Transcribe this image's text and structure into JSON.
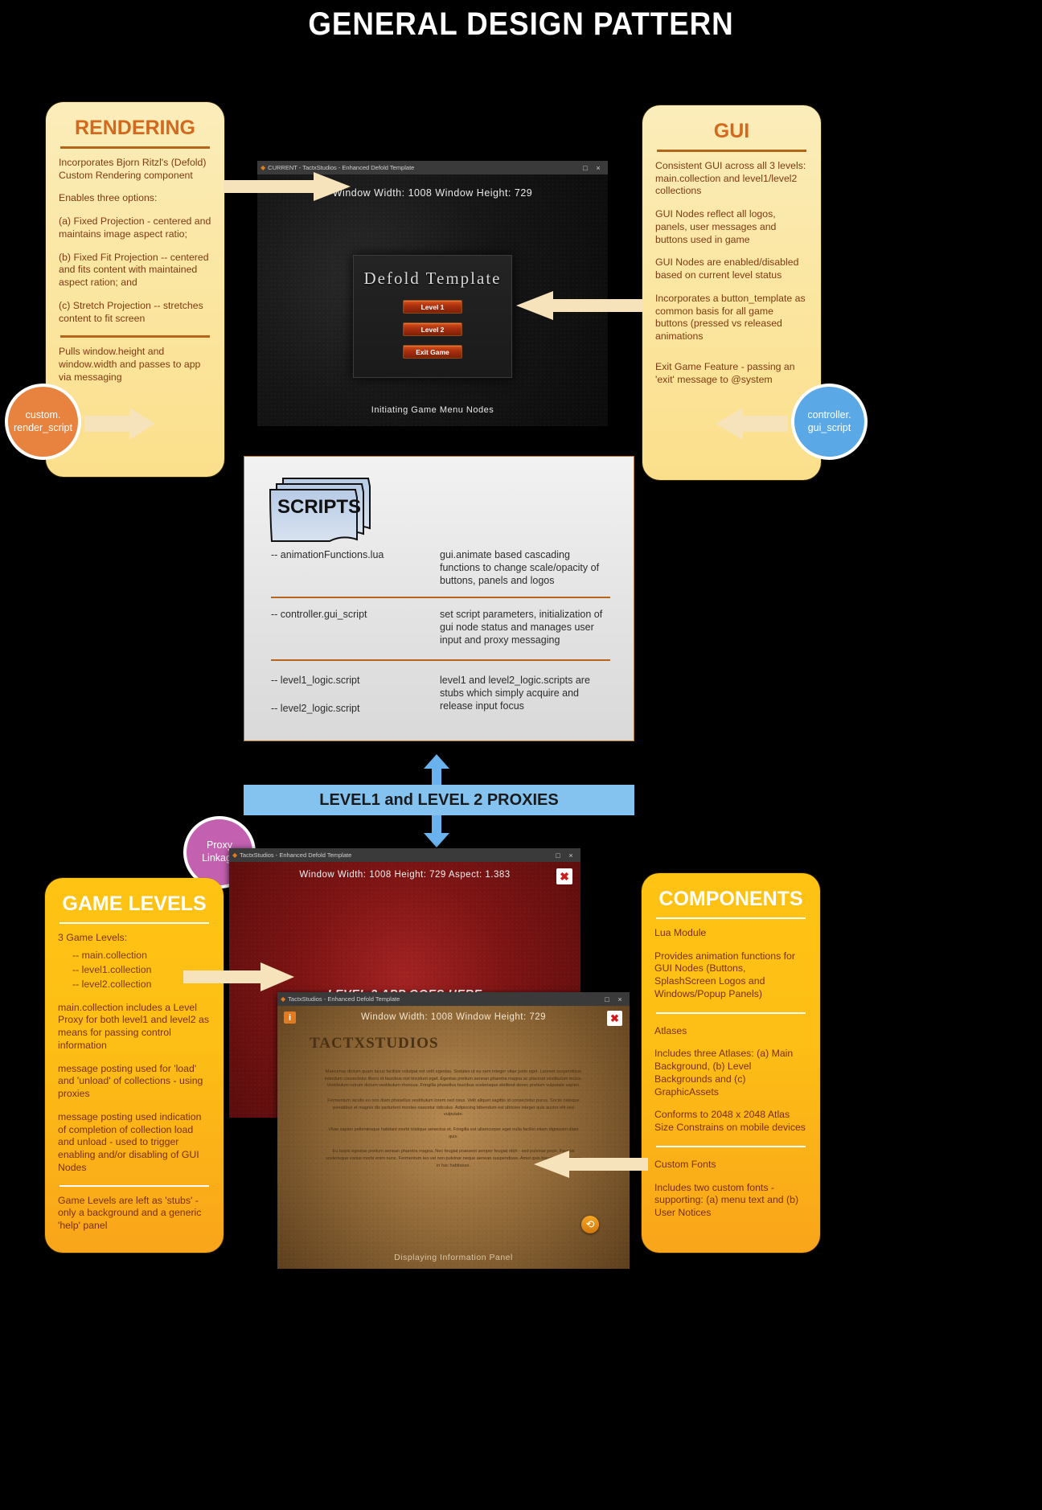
{
  "title": "GENERAL DESIGN PATTERN",
  "panels": {
    "rendering": {
      "heading": "RENDERING",
      "paras": [
        "Incorporates Bjorn Ritzl's (Defold) Custom Rendering component",
        "Enables three options:",
        "(a) Fixed Projection - centered and maintains image aspect ratio;",
        "(b) Fixed Fit Projection -- centered and fits content with maintained aspect ration; and",
        "(c) Stretch Projection -- stretches content to fit screen"
      ],
      "footer": "Pulls window.height and window.width and passes to app via messaging"
    },
    "gui": {
      "heading": "GUI",
      "paras": [
        "Consistent GUI across all 3 levels: main.collection and level1/level2 collections",
        "GUI Nodes reflect all logos, panels, user messages and buttons used in game",
        "GUI Nodes are enabled/disabled based on current level status",
        "Incorporates a button_template as common basis for all game buttons (pressed vs released animations",
        "Exit Game Feature - passing an 'exit' message to @system"
      ]
    },
    "game_levels": {
      "heading": "GAME LEVELS",
      "intro": "3 Game Levels:",
      "bullets": [
        "-- main.collection",
        "-- level1.collection",
        "-- level2.collection"
      ],
      "paras": [
        "main.collection includes a Level Proxy for both level1 and level2 as means for passing control information",
        "message posting used for 'load' and 'unload' of collections - using proxies",
        "message posting used indication of completion of collection load and unload - used to trigger enabling and/or disabling of GUI Nodes"
      ],
      "footer": "Game Levels are left as 'stubs' - only a background and a generic 'help' panel"
    },
    "components": {
      "heading": "COMPONENTS",
      "groups": [
        {
          "title": "Lua Module",
          "body": "Provides animation functions for GUI Nodes (Buttons, SplashScreen Logos and Windows/Popup Panels)"
        },
        {
          "title": "Atlases",
          "body": "Includes three Atlases: (a) Main Background, (b) Level Backgrounds and (c) GraphicAssets",
          "body2": "Conforms to 2048 x 2048 Atlas Size Constrains on mobile devices"
        },
        {
          "title": "Custom Fonts",
          "body": "Includes two custom fonts - supporting: (a) menu text and (b) User Notices"
        }
      ]
    }
  },
  "badges": {
    "render_script": "custom.\nrender_script",
    "gui_script": "controller.\ngui_script",
    "proxy_linkage": "Proxy\nLinkage"
  },
  "scripts_card": {
    "folder_label": "SCRIPTS",
    "rows": [
      {
        "name": "-- animationFunctions.lua",
        "desc": "gui.animate based cascading functions to change scale/opacity of buttons, panels and logos"
      },
      {
        "name": "-- controller.gui_script",
        "desc": "set script parameters, initialization of gui node status and manages user input and proxy messaging"
      },
      {
        "name": "-- level1_logic.script",
        "name2": "-- level2_logic.script",
        "desc": "level1 and level2_logic.scripts are stubs which simply acquire and release input focus"
      }
    ]
  },
  "proxy_bar": {
    "label": "LEVEL1 and LEVEL 2 PROXIES"
  },
  "windows": {
    "main_menu": {
      "titlebar": "CURRENT - TactxStudios - Enhanced Defold Template",
      "maximize_glyph": "□",
      "close_glyph": "×",
      "hud_top": "Window Width: 1008   Window Height: 729",
      "panel_title": "Defold Template",
      "buttons": [
        "Level 1",
        "Level 2",
        "Exit Game"
      ],
      "hud_bottom": "Initiating Game Menu Nodes"
    },
    "level2": {
      "titlebar": "TactxStudios - Enhanced Defold Template",
      "maximize_glyph": "□",
      "close_glyph": "×",
      "hud_top": "Window Width: 1008   Height: 729   Aspect: 1.383",
      "center_text": "LEVEL 2 APP GOES HERE",
      "close_badge": "✖"
    },
    "info_panel": {
      "titlebar": "TactxStudios - Enhanced Defold Template",
      "maximize_glyph": "□",
      "close_glyph": "×",
      "info_glyph": "i",
      "hud_top": "Window Width: 1008   Window Height: 729",
      "logo": "TACTXSTUDIOS",
      "paragraphs": [
        "Maecenas dictum quam lacus facilisis volutpat est velit egestas. Sodales ut eu sem integer vitae justo eget. Laoreet suspendisse interdum consectetur libero id faucibus nisl tincidunt eget. Egestas pretium aenean pharetra magna ac placerat vestibulum lectus. Vestibulum rutrum dictum vestibulum rhoncus. Fringilla phasellus faucibus scelerisque eleifend donec pretium vulputate sapien.",
        "Fermentum iaculis eu non diam phasellus vestibulum lorem sed risus. Velit aliquet sagittis id consectetur purus. Sociis natoque penatibus et magnis dis parturient montes nascetur ridiculus. Adipiscing bibendum est ultricies integer quis auctor elit sed vulputate.",
        "Vitae sapien pellentesque habitant morbi tristique senectus et. Fringilla est ullamcorper eget nulla facilisi etiam dignissim diam quis.",
        "Eu turpis egestas pretium aenean pharetra magna. Nec feugiat praesent semper feugiat nibh - sed pulvinar proin. Feugiat scelerisque varius morbi enim nunc. Fermentum leo vel non pulvinar neque aenean suspendisse. Amet quis blandit turpis cursus in hac habitasse."
      ],
      "next_glyph": "⟲",
      "hud_bottom": "Displaying Information Panel"
    }
  },
  "colors": {
    "pale_card": "#fbe8a8",
    "amber_card": "#fdbe15",
    "heading_orange": "#d2691e",
    "badge_orange": "#e8833f",
    "badge_blue": "#5aa9e6",
    "badge_purple": "#c361b0",
    "proxy_blue": "#84c2f0",
    "arrow_cream": "#f6e3bb",
    "rule_brown": "#b3651a"
  }
}
